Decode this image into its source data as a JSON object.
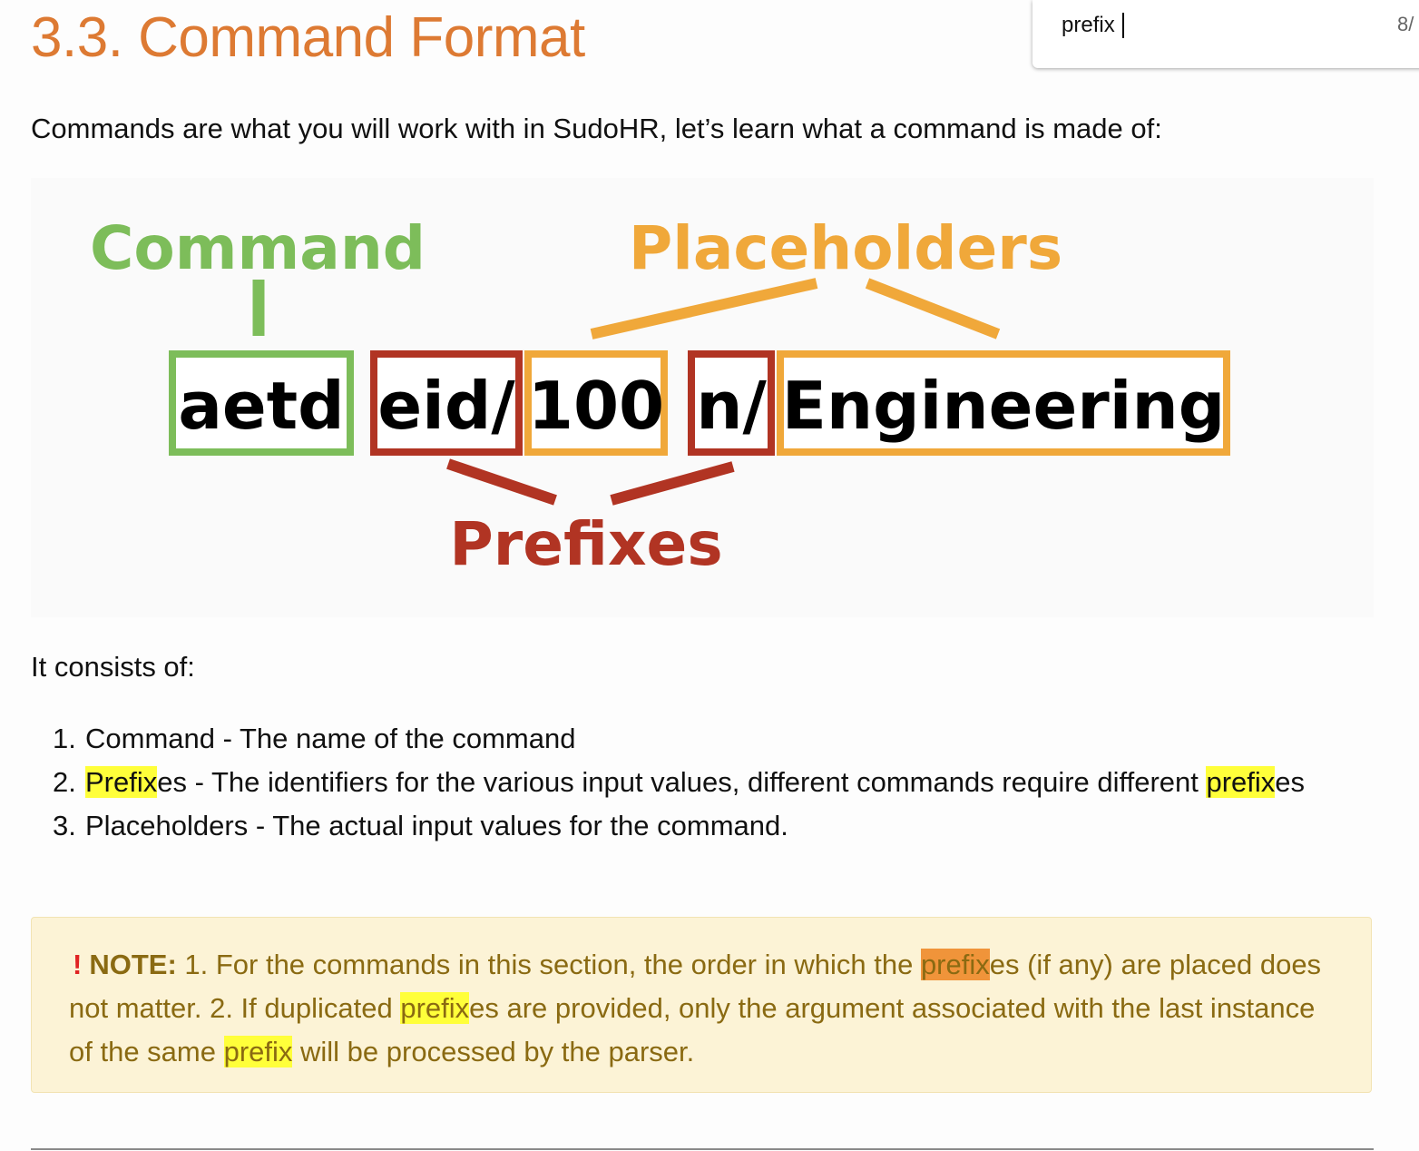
{
  "page": {
    "heading": "3.3. Command Format",
    "intro": "Commands are what you will work with in SudoHR, let’s learn what a command is made of:",
    "consists": "It consists of:"
  },
  "find_bar": {
    "query": "prefix",
    "count": "8/"
  },
  "diagram": {
    "label_command": "Command",
    "label_placeholders": "Placeholders",
    "label_prefixes": "Prefixes",
    "token_command": "aetd",
    "token_prefix_1": "eid/",
    "token_value_1": "100",
    "token_prefix_2": "n/",
    "token_value_2": "Engineering",
    "colors": {
      "command": "#7dbd5a",
      "placeholder": "#f0a83a",
      "prefix": "#b13423"
    }
  },
  "steps": [
    {
      "num": "1.",
      "term": "Command",
      "desc": " - The name of the command"
    },
    {
      "num": "2.",
      "term_hl": "Prefix",
      "term_rest": "es",
      "desc": " - The identifiers for the various input values, different commands require different ",
      "tail_hl": "prefix",
      "tail_rest": "es"
    },
    {
      "num": "3.",
      "term": "Placeholders",
      "desc": " - The actual input values for the command."
    }
  ],
  "note": {
    "icon": "!",
    "label": "NOTE:",
    "t1": " 1. For the commands in this section, the order in which the ",
    "hl1": "prefix",
    "t2": "es (if any) are placed does not matter. 2. If duplicated ",
    "hl2": "prefix",
    "t3": "es are provided, only the argument associated with the last instance of the same ",
    "hl3": "prefix",
    "t4": " will be processed by the parser."
  },
  "colors": {
    "heading": "#dd7a33",
    "highlight": "#ffff3a",
    "highlight_current": "#f0943a",
    "note_bg": "#fcf3d6",
    "note_text": "#8a6a12"
  }
}
